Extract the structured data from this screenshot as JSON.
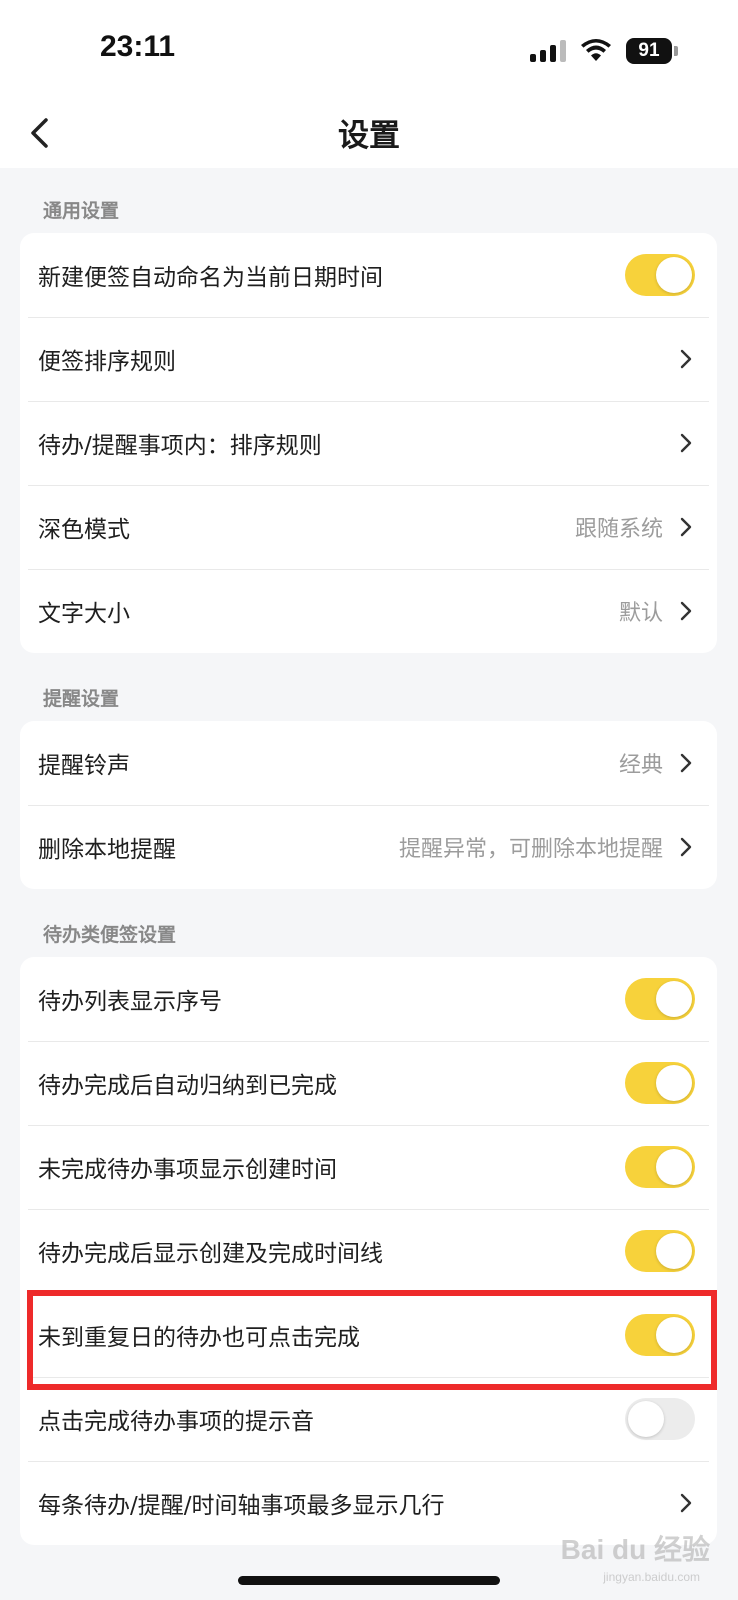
{
  "status_bar": {
    "time": "23:11",
    "battery": "91"
  },
  "nav": {
    "title": "设置"
  },
  "sections": {
    "general": {
      "header": "通用设置",
      "rows": [
        {
          "label": "新建便签自动命名为当前日期时间",
          "toggle": true
        },
        {
          "label": "便签排序规则"
        },
        {
          "label": "待办/提醒事项内：排序规则"
        },
        {
          "label": "深色模式",
          "value": "跟随系统"
        },
        {
          "label": "文字大小",
          "value": "默认"
        }
      ]
    },
    "reminder": {
      "header": "提醒设置",
      "rows": [
        {
          "label": "提醒铃声",
          "value": "经典"
        },
        {
          "label": "删除本地提醒",
          "value": "提醒异常，可删除本地提醒"
        }
      ]
    },
    "todo": {
      "header": "待办类便签设置",
      "rows": [
        {
          "label": "待办列表显示序号",
          "toggle": true
        },
        {
          "label": "待办完成后自动归纳到已完成",
          "toggle": true
        },
        {
          "label": "未完成待办事项显示创建时间",
          "toggle": true
        },
        {
          "label": "待办完成后显示创建及完成时间线",
          "toggle": true
        },
        {
          "label": "未到重复日的待办也可点击完成",
          "toggle": true
        },
        {
          "label": "点击完成待办事项的提示音",
          "toggle": false
        },
        {
          "label": "每条待办/提醒/时间轴事项最多显示几行"
        }
      ]
    }
  },
  "watermark": {
    "text": "Bai du 经验",
    "sub": "jingyan.baidu.com"
  },
  "colors": {
    "accent": "#f7d23b",
    "highlight": "#ee2a2a"
  }
}
